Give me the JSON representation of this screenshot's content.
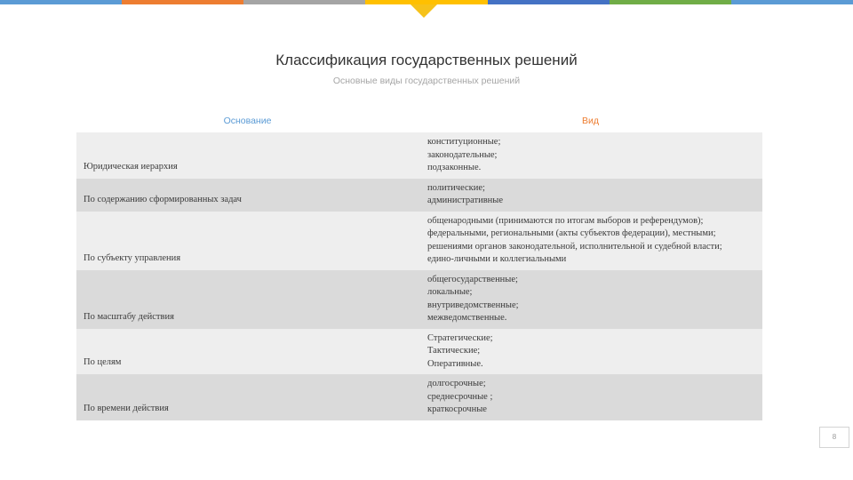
{
  "colors": {
    "top_bar": [
      "#5b9bd5",
      "#ed7d31",
      "#a5a5a5",
      "#ffc000",
      "#4472c4",
      "#70ad47",
      "#5b9bd5"
    ],
    "header_left": "#5b9bd5",
    "header_right": "#ed7d31",
    "notch": "#f6c21a"
  },
  "slide": {
    "title": "Классификация государственных решений",
    "subtitle": "Основные виды государственных решений",
    "page_number": "8"
  },
  "table": {
    "headers": {
      "basis": "Основание",
      "type": "Вид"
    },
    "rows": [
      {
        "basis": "Юридическая иерархия",
        "types": [
          "конституционные;",
          " законодательные;",
          " подзаконные."
        ],
        "wrap": []
      },
      {
        "basis": "По содержанию сформированных задач",
        "types": [
          "политические;",
          "административные"
        ],
        "wrap": []
      },
      {
        "basis": "По субъекту управления",
        "types": [
          "общенародными (принимаются по итогам выборов и референдумов);",
          "    федеральными, региональными (акты субъектов федерации), местными;",
          "    решениями органов законодательной, исполнительной и судебной власти;",
          " едино-личными и коллегиальными"
        ],
        "wrap": [
          1,
          2
        ]
      },
      {
        "basis": "По масштабу действия",
        "types": [
          "общегосударственные;",
          "локальные;",
          "внутриведомственные;",
          "межведомственные."
        ],
        "wrap": []
      },
      {
        "basis": "По целям",
        "types": [
          "Стратегические;",
          "Тактические;",
          "Оперативные."
        ],
        "wrap": []
      },
      {
        "basis": "По времени действия",
        "types": [
          "долгосрочные;",
          "среднесрочные ;",
          "краткосрочные"
        ],
        "wrap": []
      }
    ]
  }
}
